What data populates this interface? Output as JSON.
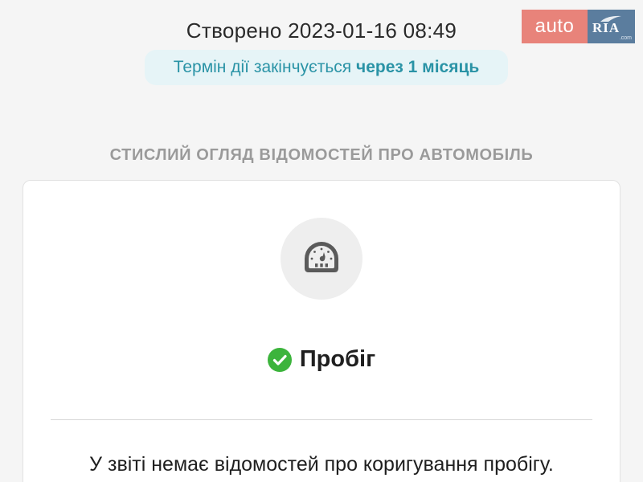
{
  "logo": {
    "auto_text": "auto",
    "ria_text": "RIA",
    "ria_com": ".com"
  },
  "header": {
    "created": "Створено 2023-01-16 08:49",
    "expiry_prefix": "Термін дії закінчується ",
    "expiry_highlight": "через 1 місяць"
  },
  "section": {
    "title": "СТИСЛИЙ ОГЛЯД ВІДОМОСТЕЙ ПРО АВТОМОБІЛЬ"
  },
  "card": {
    "icon": "speedometer-icon",
    "status_icon": "check-circle-icon",
    "title": "Пробіг",
    "description": "У звіті немає відомостей про коригування пробігу."
  },
  "colors": {
    "background": "#f5f5f5",
    "logo_auto": "#e8837a",
    "logo_ria": "#5b7d9e",
    "expiry_bg": "#e6f4f7",
    "expiry_text": "#2a93a6",
    "check_green": "#3cb43c",
    "section_title": "#9a9a9a"
  }
}
